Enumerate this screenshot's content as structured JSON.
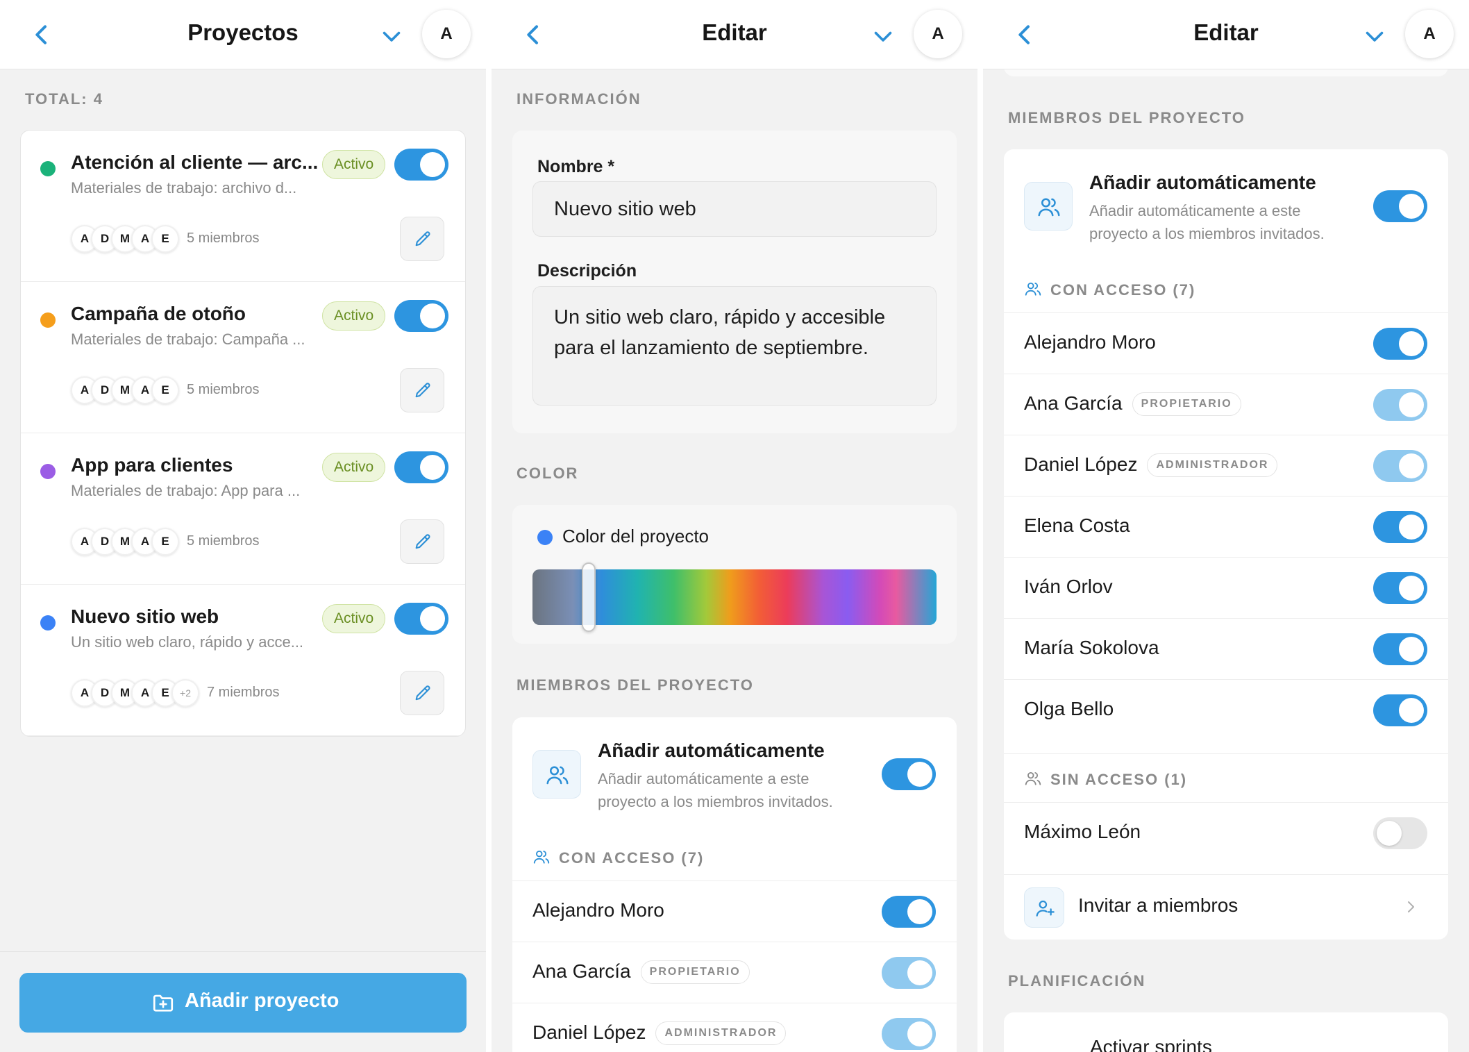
{
  "panels": {
    "list": {
      "header": {
        "title": "Proyectos",
        "avatar": "A"
      },
      "total_label": "TOTAL: 4",
      "status_active": "Activo",
      "projects": [
        {
          "name": "Atención al cliente — arc...",
          "description": "Materiales de trabajo: archivo d...",
          "color": "#1bb27a",
          "avatars": [
            "A",
            "D",
            "M",
            "A",
            "E"
          ],
          "extra": "",
          "members": "5 miembros",
          "active": true
        },
        {
          "name": "Campaña de otoño",
          "description": "Materiales de trabajo: Campaña ...",
          "color": "#f59e1b",
          "avatars": [
            "A",
            "D",
            "M",
            "A",
            "E"
          ],
          "extra": "",
          "members": "5 miembros",
          "active": true
        },
        {
          "name": "App para clientes",
          "description": "Materiales de trabajo: App para ...",
          "color": "#9b5de5",
          "avatars": [
            "A",
            "D",
            "M",
            "A",
            "E"
          ],
          "extra": "",
          "members": "5 miembros",
          "active": true
        },
        {
          "name": "Nuevo sitio web",
          "description": "Un sitio web claro, rápido y acce...",
          "color": "#3b82f6",
          "avatars": [
            "A",
            "D",
            "M",
            "A",
            "E"
          ],
          "extra": "+2",
          "members": "7 miembros",
          "active": true
        }
      ],
      "add_button": "Añadir proyecto"
    },
    "edit": {
      "header": {
        "title": "Editar",
        "avatar": "A"
      },
      "info_label": "INFORMACIÓN",
      "name_label": "Nombre *",
      "name_value": "Nuevo sitio web",
      "description_label": "Descripción",
      "description_value": "Un sitio web claro, rápido y accesible para el lanzamiento de septiembre.",
      "color_label": "COLOR",
      "color_field_label": "Color del proyecto",
      "project_color": "#3b82f6",
      "color_slider_value": 0.14,
      "members_label": "MIEMBROS DEL PROYECTO",
      "auto_title": "Añadir automáticamente",
      "auto_desc": "Añadir automáticamente a este proyecto a los miembros invitados.",
      "with_access_label": "CON ACCESO (7)",
      "members": [
        {
          "name": "Alejandro Moro",
          "role": "",
          "state": "on"
        },
        {
          "name": "Ana García",
          "role": "PROPIETARIO",
          "state": "locked"
        },
        {
          "name": "Daniel López",
          "role": "ADMINISTRADOR",
          "state": "locked"
        }
      ]
    },
    "members": {
      "header": {
        "title": "Editar",
        "avatar": "A"
      },
      "members_label": "MIEMBROS DEL PROYECTO",
      "auto_title": "Añadir automáticamente",
      "auto_desc": "Añadir automáticamente a este proyecto a los miembros invitados.",
      "with_access_label": "CON ACCESO (7)",
      "with_access": [
        {
          "name": "Alejandro Moro",
          "role": "",
          "state": "on"
        },
        {
          "name": "Ana García",
          "role": "PROPIETARIO",
          "state": "locked"
        },
        {
          "name": "Daniel López",
          "role": "ADMINISTRADOR",
          "state": "locked"
        },
        {
          "name": "Elena Costa",
          "role": "",
          "state": "on"
        },
        {
          "name": "Iván Orlov",
          "role": "",
          "state": "on"
        },
        {
          "name": "María Sokolova",
          "role": "",
          "state": "on"
        },
        {
          "name": "Olga Bello",
          "role": "",
          "state": "on"
        }
      ],
      "without_access_label": "SIN ACCESO (1)",
      "without_access": [
        {
          "name": "Máximo León",
          "role": "",
          "state": "off"
        }
      ],
      "invite_label": "Invitar a miembros",
      "planning_label": "PLANIFICACIÓN",
      "sprints_label": "Activar sprints"
    }
  },
  "accent_color": "#2d95e0"
}
